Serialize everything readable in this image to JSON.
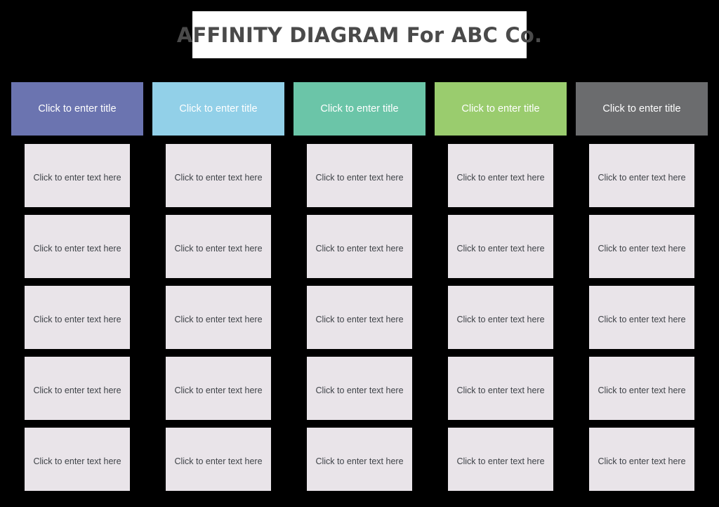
{
  "title": {
    "text": "AFFINITY DIAGRAM For ABC Co.",
    "panel_background": "#ffffff",
    "text_color": "#4a4a4a"
  },
  "board": {
    "background": "#000000",
    "card_background": "#e9e4e9",
    "card_text_color": "#3f4348",
    "header_text_color": "#ffffff",
    "columns": [
      {
        "header_label": "Click to enter title",
        "header_color": "#6b74b0",
        "cards": [
          {
            "label": "Click to enter text here"
          },
          {
            "label": "Click to enter text here"
          },
          {
            "label": "Click to enter text here"
          },
          {
            "label": "Click to enter text here"
          },
          {
            "label": "Click to enter text here"
          }
        ]
      },
      {
        "header_label": "Click to enter title",
        "header_color": "#92d0e8",
        "cards": [
          {
            "label": "Click to enter text here"
          },
          {
            "label": "Click to enter text here"
          },
          {
            "label": "Click to enter text here"
          },
          {
            "label": "Click to enter text here"
          },
          {
            "label": "Click to enter text here"
          }
        ]
      },
      {
        "header_label": "Click to enter title",
        "header_color": "#6bc5a8",
        "cards": [
          {
            "label": "Click to enter text here"
          },
          {
            "label": "Click to enter text here"
          },
          {
            "label": "Click to enter text here"
          },
          {
            "label": "Click to enter text here"
          },
          {
            "label": "Click to enter text here"
          }
        ]
      },
      {
        "header_label": "Click to enter title",
        "header_color": "#9acc6e",
        "cards": [
          {
            "label": "Click to enter text here"
          },
          {
            "label": "Click to enter text here"
          },
          {
            "label": "Click to enter text here"
          },
          {
            "label": "Click to enter text here"
          },
          {
            "label": "Click to enter text here"
          }
        ]
      },
      {
        "header_label": "Click to enter title",
        "header_color": "#6b6c6e",
        "cards": [
          {
            "label": "Click to enter text here"
          },
          {
            "label": "Click to enter text here"
          },
          {
            "label": "Click to enter text here"
          },
          {
            "label": "Click to enter text here"
          },
          {
            "label": "Click to enter text here"
          }
        ]
      }
    ]
  }
}
